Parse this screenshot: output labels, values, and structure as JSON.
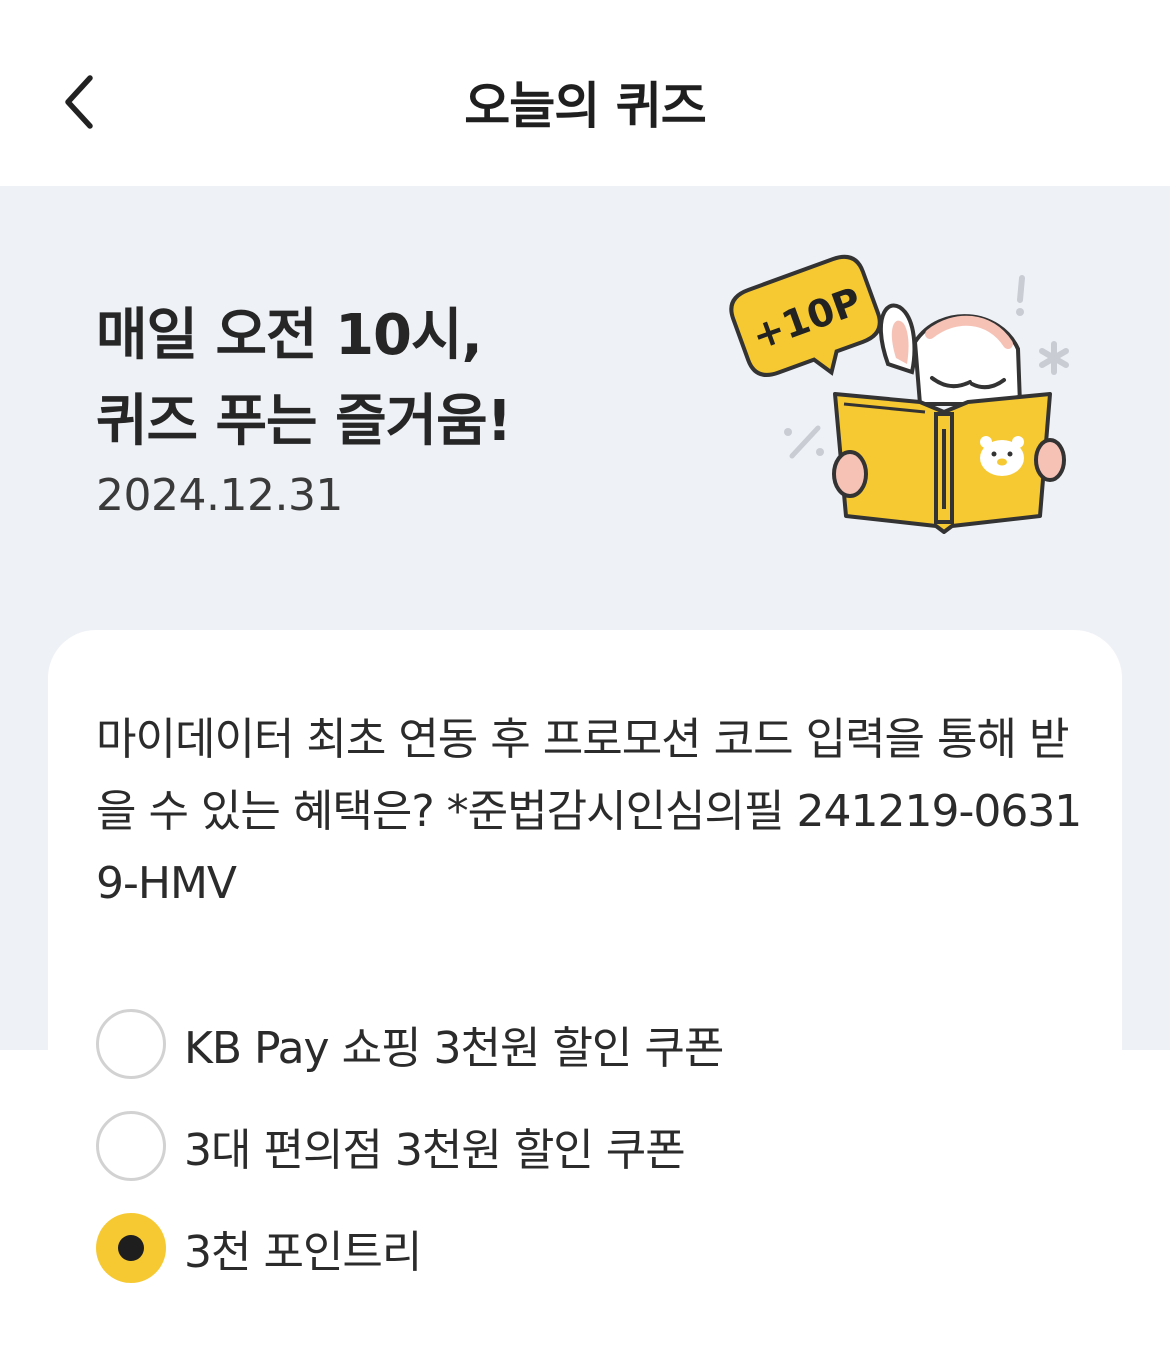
{
  "header": {
    "title": "오늘의 퀴즈",
    "back_icon": "chevron-left-icon"
  },
  "hero": {
    "line1": "매일 오전 10시,",
    "line2": "퀴즈 푸는 즐거움!",
    "date": "2024.12.31",
    "badge": "+10P",
    "illustration": "rabbit-reading-book-illustration"
  },
  "quiz": {
    "question": "마이데이터 최초 연동 후 프로모션 코드 입력을 통해 받을 수 있는 혜택은? *준법감시인심의필 241219-06319-HMV",
    "options": [
      {
        "label": "KB Pay 쇼핑 3천원 할인 쿠폰",
        "selected": false
      },
      {
        "label": "3대 편의점 3천원 할인 쿠폰",
        "selected": false
      },
      {
        "label": "3천 포인트리",
        "selected": true
      }
    ]
  },
  "colors": {
    "accent": "#f6c932",
    "hero_bg": "#eef1f6",
    "radio_border": "#d2d2d2"
  }
}
